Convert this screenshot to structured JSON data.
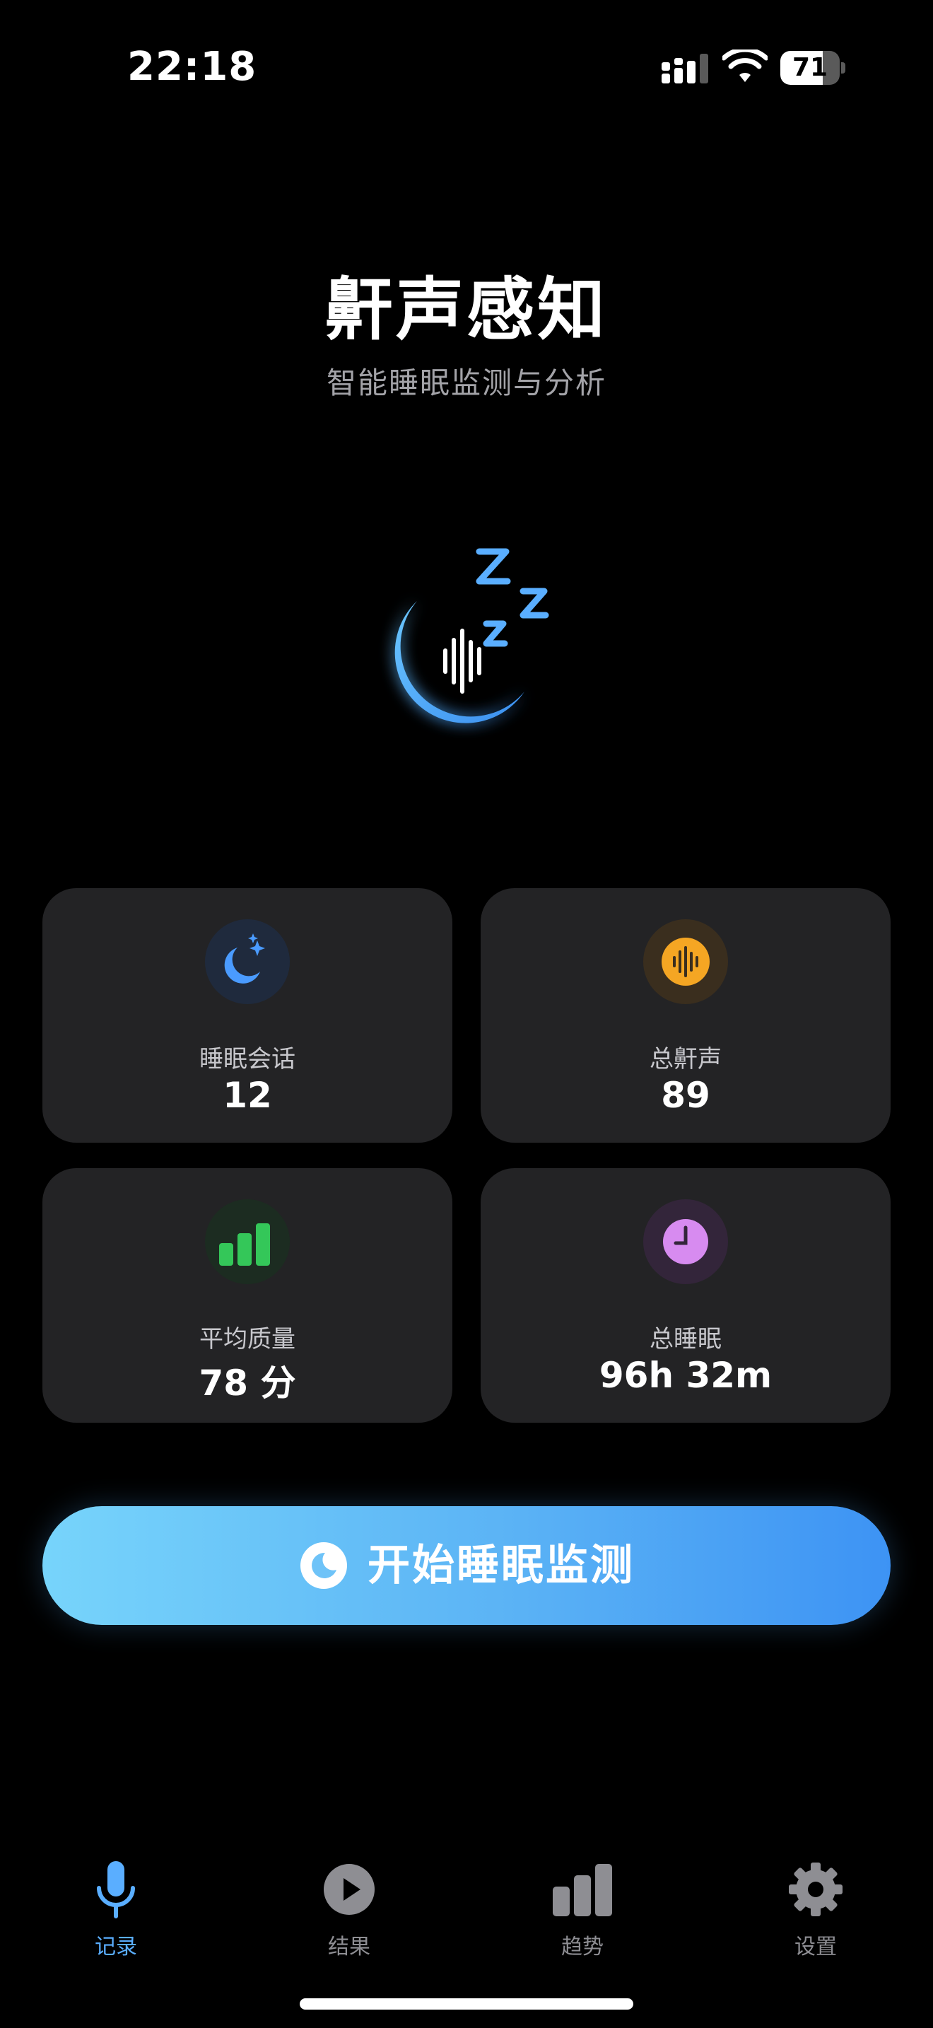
{
  "status_bar": {
    "time": "22:18",
    "battery_level": "71",
    "battery_fraction": 0.71
  },
  "header": {
    "title": "鼾声感知",
    "subtitle": "智能睡眠监测与分析"
  },
  "stats": [
    {
      "label": "睡眠会话",
      "value": "12",
      "icon": "moon-stars-icon",
      "color": "#3b82f6"
    },
    {
      "label": "总鼾声",
      "value": "89",
      "icon": "waveform-icon",
      "color": "#f5a623"
    },
    {
      "label": "平均质量",
      "value": "78 分",
      "icon": "bar-chart-icon",
      "color": "#34c759"
    },
    {
      "label": "总睡眠",
      "value": "96h 32m",
      "icon": "clock-icon",
      "color": "#c77dea"
    }
  ],
  "cta": {
    "label": "开始睡眠监测",
    "icon": "moon-icon"
  },
  "tabs": [
    {
      "label": "记录",
      "icon": "microphone-icon",
      "active": true
    },
    {
      "label": "结果",
      "icon": "play-circle-icon",
      "active": false
    },
    {
      "label": "趋势",
      "icon": "bar-chart-icon",
      "active": false
    },
    {
      "label": "设置",
      "icon": "gear-icon",
      "active": false
    }
  ],
  "colors": {
    "accent": "#5aaeff",
    "tab_inactive": "#8e8e93",
    "card_bg": "#232325",
    "background": "#000000"
  }
}
